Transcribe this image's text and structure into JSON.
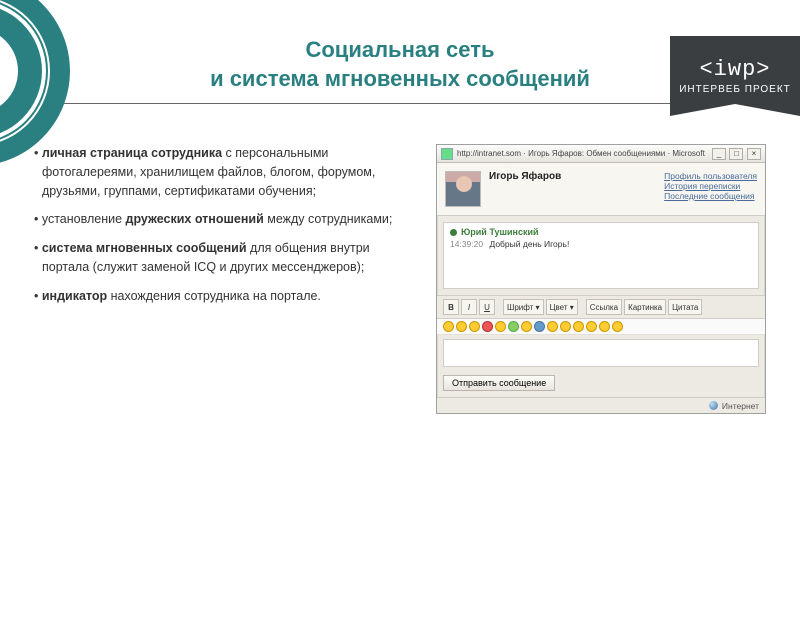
{
  "badge": {
    "line1": "<iwp>",
    "line2": "ИНТЕРВЕБ ПРОЕКТ"
  },
  "title": {
    "line1": "Социальная сеть",
    "line2": "и система мгновенных сообщений"
  },
  "bullets": [
    {
      "pre": "",
      "bold": "личная страница сотрудника",
      "post": " с персональными фотогалереями, хранилищем файлов, блогом, форумом, друзьями, группами, сертификатами обучения;"
    },
    {
      "pre": "установление ",
      "bold": "дружеских отношений",
      "post": " между сотрудниками;"
    },
    {
      "pre": "",
      "bold": "система мгновенных сообщений",
      "post": " для общения внутри портала (служит заменой ICQ и других мессенджеров);"
    },
    {
      "pre": "",
      "bold": "индикатор",
      "post": " нахождения сотрудника на портале."
    }
  ],
  "shot": {
    "titlebar": "http://intranet.som · Игорь Яфаров: Обмен сообщениями · Microsoft Internet Explorer",
    "profile_name": "Игорь Яфаров",
    "links": [
      "Профиль пользователя",
      "История переписки",
      "Последние сообщения"
    ],
    "msg_author": "Юрий Тушинский",
    "msg_time": "14:39:20",
    "msg_text": "Добрый день Игорь!",
    "tool_labels": {
      "b": "B",
      "i": "I",
      "u": "U",
      "font": "Шрифт ▾",
      "color": "Цвет ▾",
      "link": "Ссылка",
      "image": "Картинка",
      "quote": "Цитата"
    },
    "send": "Отправить сообщение",
    "status": "Интернет"
  }
}
